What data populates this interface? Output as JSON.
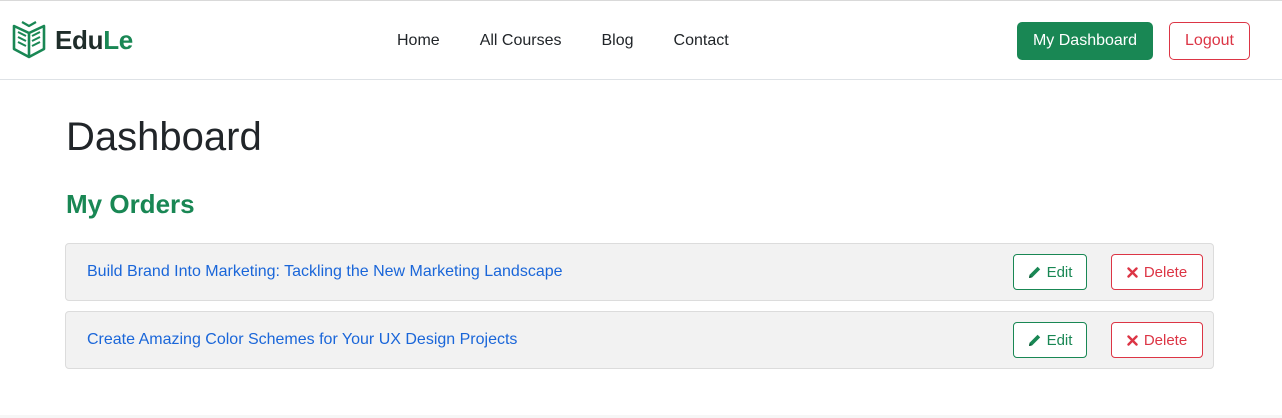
{
  "brand": {
    "name_part1": "Edu",
    "name_part2": "Le",
    "logo_icon": "open-book-shield-icon",
    "color_dark": "#1f2d2a",
    "color_accent": "#198754"
  },
  "nav": {
    "items": [
      {
        "label": "Home"
      },
      {
        "label": "All Courses"
      },
      {
        "label": "Blog"
      },
      {
        "label": "Contact"
      }
    ],
    "dashboard_label": "My Dashboard",
    "logout_label": "Logout"
  },
  "page": {
    "title": "Dashboard",
    "section_title": "My Orders"
  },
  "orders": [
    {
      "title": "Build Brand Into Marketing: Tackling the New Marketing Landscape",
      "edit_label": "Edit",
      "delete_label": "Delete"
    },
    {
      "title": "Create Amazing Color Schemes for Your UX Design Projects",
      "edit_label": "Edit",
      "delete_label": "Delete"
    }
  ],
  "icons": {
    "edit": "pencil-icon",
    "delete": "x-mark-icon"
  },
  "colors": {
    "success": "#198754",
    "danger": "#dc3545",
    "link": "#1a66d9",
    "row_bg": "#f2f2f2"
  }
}
